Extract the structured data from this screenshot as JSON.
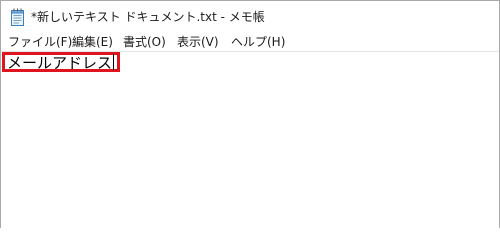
{
  "window": {
    "title": "*新しいテキスト ドキュメント.txt - メモ帳",
    "icon": "notepad-icon"
  },
  "menubar": {
    "items": [
      {
        "label": "ファイル(F)"
      },
      {
        "label": "編集(E)"
      },
      {
        "label": "書式(O)"
      },
      {
        "label": "表示(V)"
      },
      {
        "label": "ヘルプ(H)"
      }
    ]
  },
  "editor": {
    "content": "メールアドレス",
    "highlight_color": "#e0141e"
  }
}
